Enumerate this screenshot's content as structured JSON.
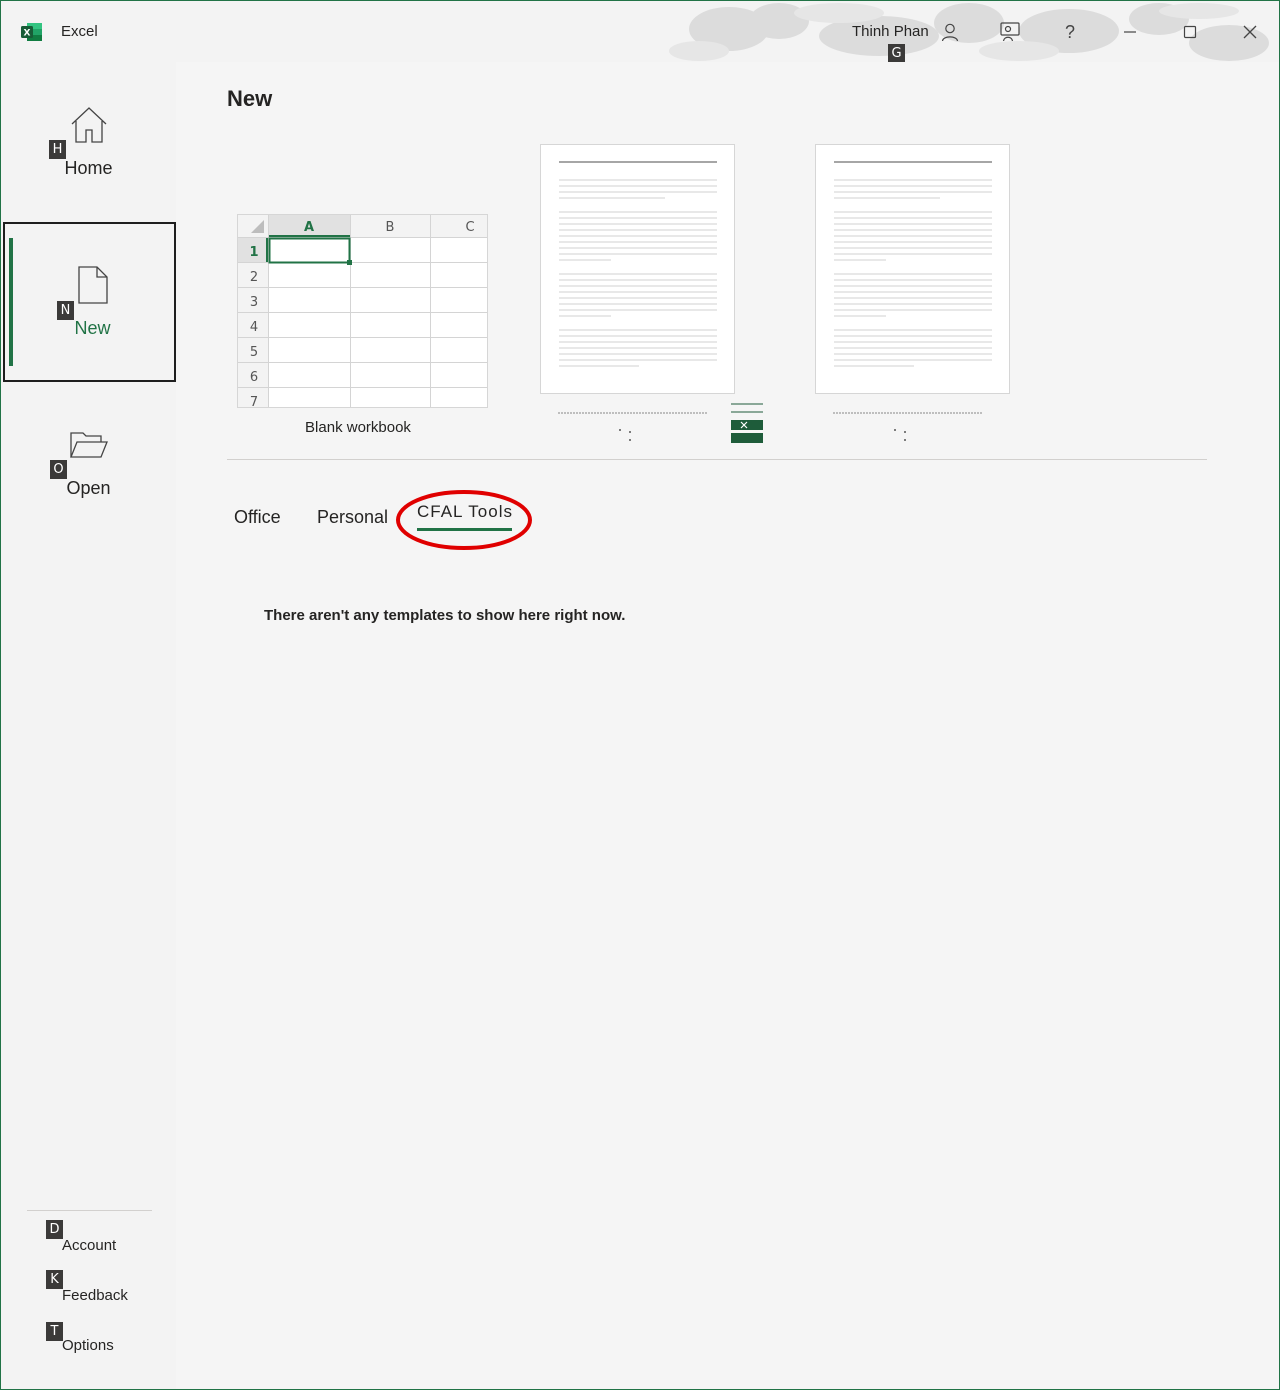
{
  "titlebar": {
    "app_title": "Excel",
    "user_name": "Thinh Phan",
    "user_keytip": "G",
    "help_label": "?",
    "brand_color": "#217346"
  },
  "sidebar": {
    "items": [
      {
        "label": "Home",
        "keytip": "H",
        "icon": "home-icon"
      },
      {
        "label": "New",
        "keytip": "N",
        "icon": "new-document-icon",
        "active": true
      },
      {
        "label": "Open",
        "keytip": "O",
        "icon": "open-folder-icon"
      }
    ],
    "bottom_items": [
      {
        "label": "Account",
        "keytip": "D"
      },
      {
        "label": "Feedback",
        "keytip": "K"
      },
      {
        "label": "Options",
        "keytip": "T"
      }
    ]
  },
  "main": {
    "title": "New",
    "blank_workbook": {
      "label": "Blank workbook",
      "columns": [
        "A",
        "B",
        "C"
      ],
      "rows": [
        "1",
        "2",
        "3",
        "4",
        "5",
        "6",
        "7"
      ]
    },
    "tabs": [
      {
        "label": "Office"
      },
      {
        "label": "Personal"
      },
      {
        "label": "CFAL Tools",
        "selected": true
      }
    ],
    "empty_message": "There aren't any templates to show here right now."
  }
}
